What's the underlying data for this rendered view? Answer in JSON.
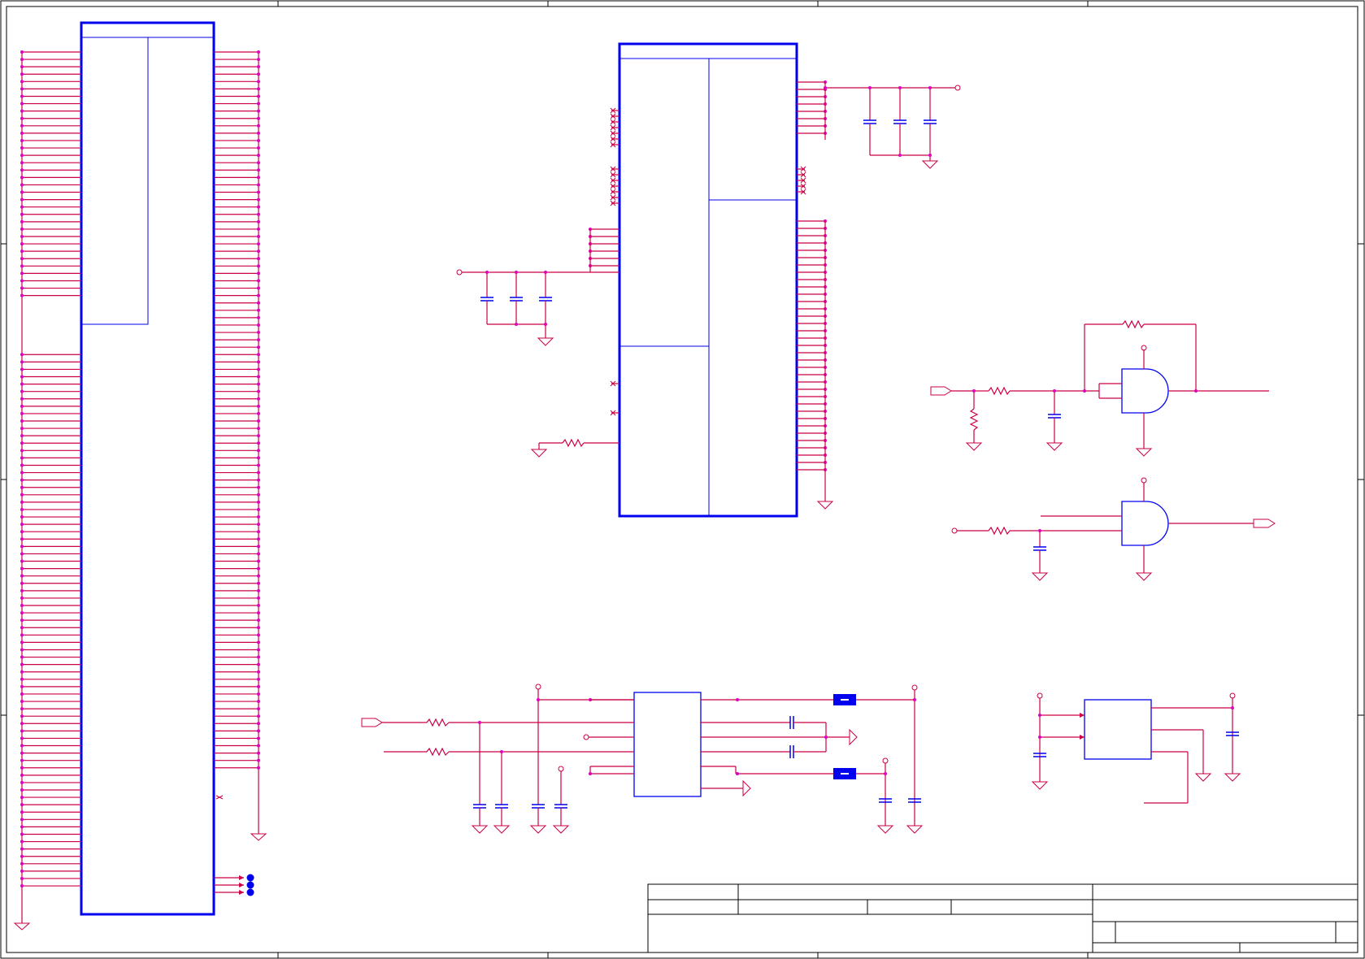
{
  "schematic": {
    "title": "",
    "colors": {
      "wire": "#cc0044",
      "component": "#0000ee",
      "junction": "#e000c0",
      "frame": "#000000",
      "fill_pad": "#0000ee"
    },
    "components": [
      {
        "kind": "connector",
        "name": "main-connector"
      },
      {
        "kind": "ic",
        "name": "main-ic"
      },
      {
        "kind": "and-gate",
        "name": "gate-1"
      },
      {
        "kind": "and-gate",
        "name": "gate-2"
      },
      {
        "kind": "ic",
        "name": "bottom-ic"
      },
      {
        "kind": "ic",
        "name": "regulator-ic"
      }
    ],
    "title_block": {
      "fields": []
    }
  }
}
